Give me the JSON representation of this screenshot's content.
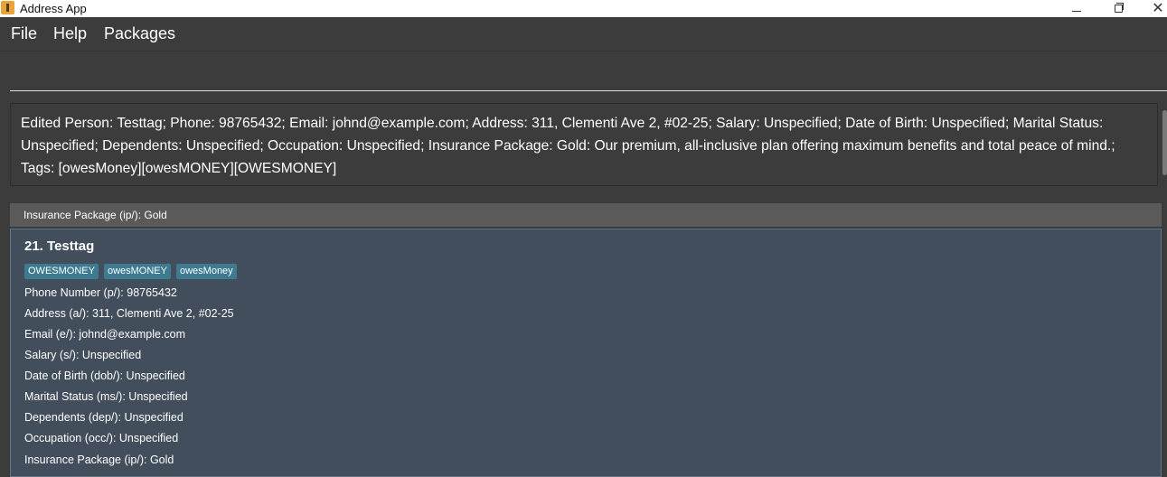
{
  "window": {
    "title": "Address App",
    "minimize_glyph": "—",
    "maximize_glyph": "▢",
    "close_glyph": "✕"
  },
  "menu": {
    "items": [
      {
        "label": "File"
      },
      {
        "label": "Help"
      },
      {
        "label": "Packages"
      }
    ]
  },
  "command_box": {
    "value": "",
    "placeholder": ""
  },
  "result_display": {
    "text": "Edited Person: Testtag; Phone: 98765432; Email: johnd@example.com; Address: 311, Clementi Ave 2, #02-25; Salary: Unspecified; Date of Birth: Unspecified; Marital Status: Unspecified; Dependents: Unspecified; Occupation: Unspecified; Insurance Package: Gold: Our premium, all-inclusive plan offering maximum benefits and total peace of mind.; Tags: [owesMoney][owesMONEY][OWESMONEY]"
  },
  "list": {
    "header": "Insurance Package (ip/): Gold",
    "person": {
      "name": "21. Testtag",
      "tags": [
        "OWESMONEY",
        "owesMONEY",
        "owesMoney"
      ],
      "phone": "Phone Number (p/): 98765432",
      "address": "Address (a/): 311, Clementi Ave 2, #02-25",
      "email": "Email (e/): johnd@example.com",
      "salary": "Salary (s/): Unspecified",
      "dob": "Date of Birth (dob/): Unspecified",
      "marital": "Marital Status (ms/): Unspecified",
      "dependents": "Dependents (dep/): Unspecified",
      "occupation": "Occupation (occ/): Unspecified",
      "insurance": "Insurance Package (ip/): Gold"
    }
  },
  "colors": {
    "background": "#3c3c3c",
    "card": "#424e5c",
    "tag": "#3e7b91",
    "list_header": "#5a5a5a"
  }
}
